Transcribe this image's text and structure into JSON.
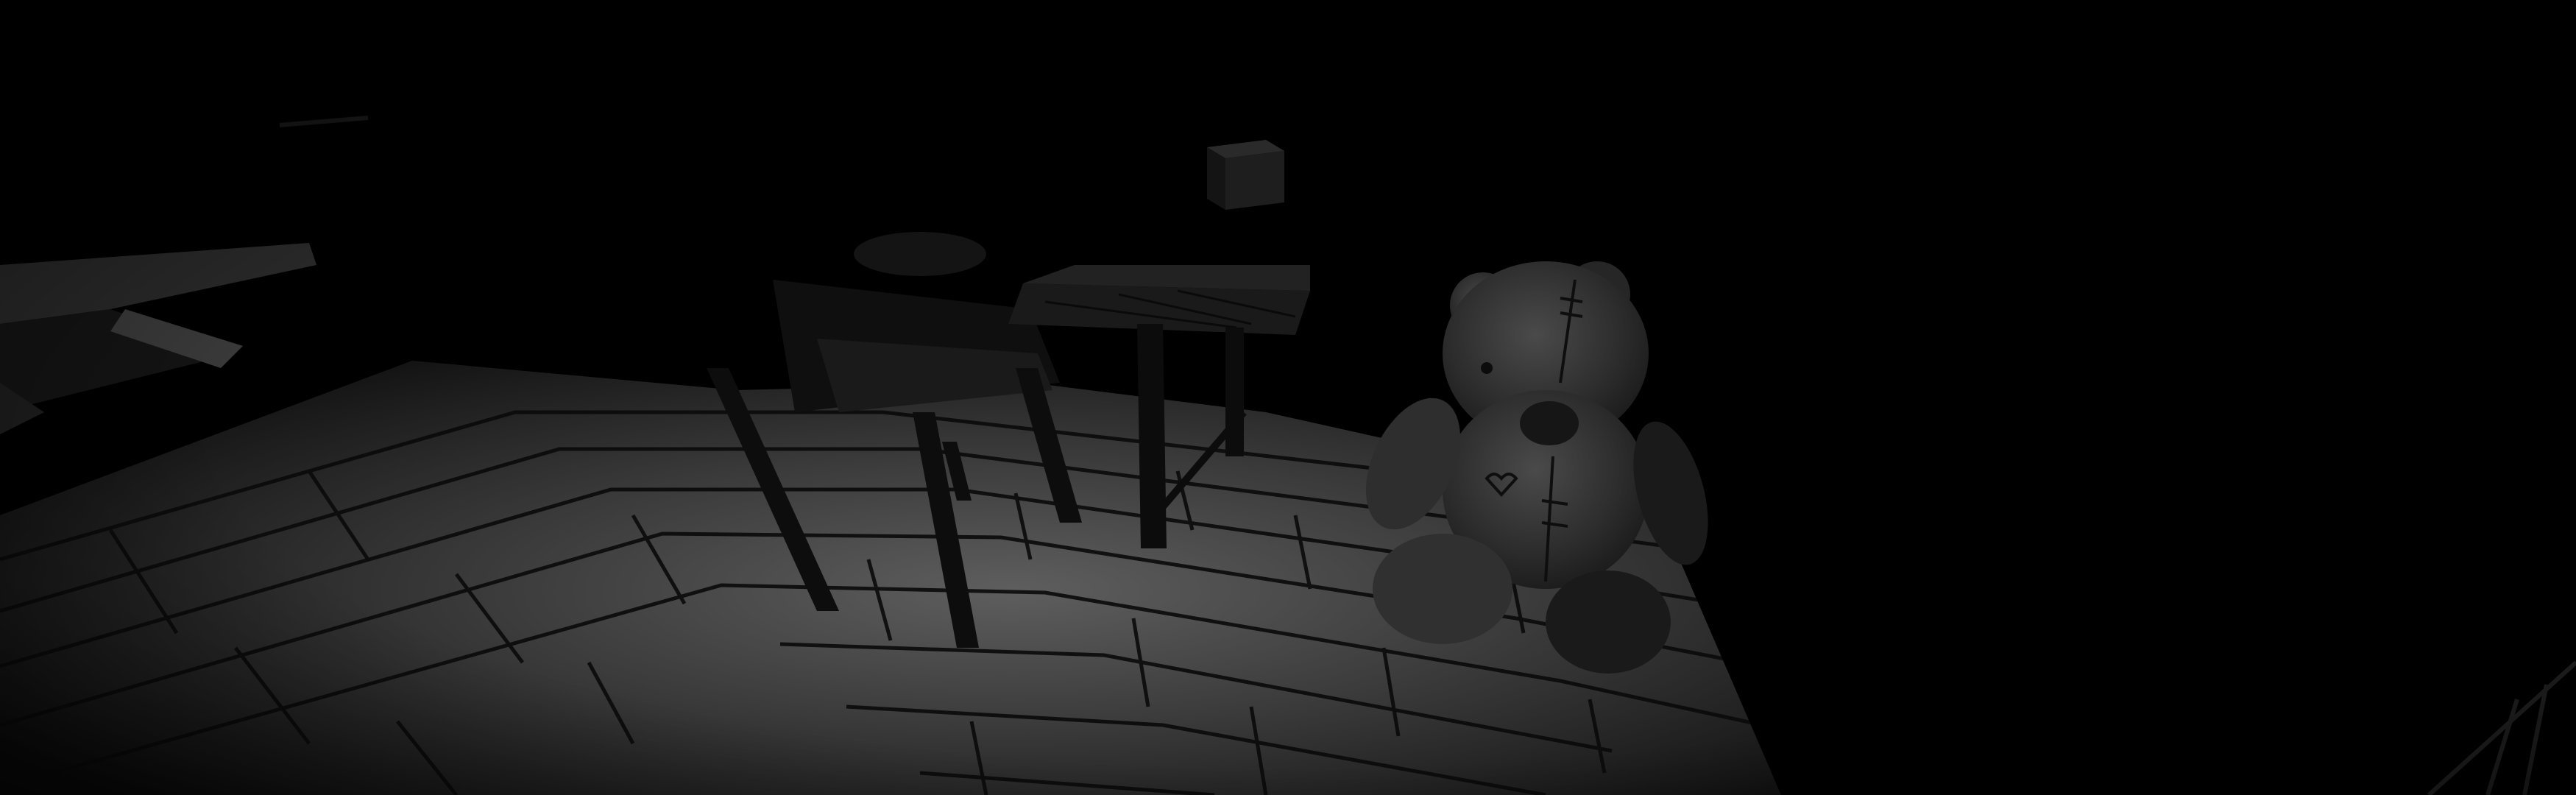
{
  "scene": {
    "type": "first-person horror game scene",
    "hud_visible": false,
    "ui_text": []
  },
  "palette": {
    "background": "#000000",
    "floor_light": "#5e5e5e",
    "floor_mid": "#3a3a3a",
    "floor_dark": "#121212",
    "plank_line": "#0a0a0a",
    "furniture": "#0f0f0f",
    "teddy_light": "#4a4a4a",
    "teddy_dark": "#1c1c1c"
  },
  "objects": [
    {
      "name": "wooden-floor"
    },
    {
      "name": "chair"
    },
    {
      "name": "side-table"
    },
    {
      "name": "candle-block"
    },
    {
      "name": "teddy-bear"
    },
    {
      "name": "shelf-left"
    },
    {
      "name": "railing-right"
    }
  ]
}
